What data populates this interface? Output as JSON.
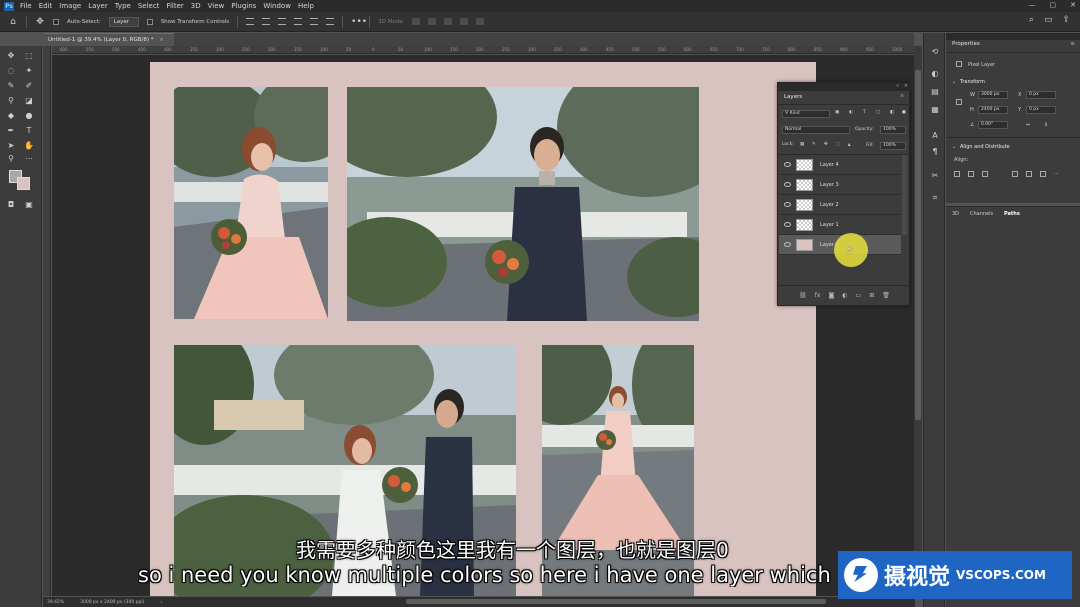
{
  "menu": [
    "File",
    "Edit",
    "Image",
    "Layer",
    "Type",
    "Select",
    "Filter",
    "3D",
    "View",
    "Plugins",
    "Window",
    "Help"
  ],
  "options_bar": {
    "auto_select_label": "Auto-Select:",
    "auto_select_value": "Layer",
    "transform_controls_label": "Show Transform Controls",
    "mode_3d": "3D Mode:"
  },
  "document": {
    "tab_title": "Untitled-1 @ 39.4% (Layer 0, RGB/8) *",
    "zoom": "39.42%",
    "doc_info": "3000 px x 2400 px (300 ppi)"
  },
  "ruler_top": [
    "600",
    "550",
    "500",
    "450",
    "400",
    "350",
    "300",
    "250",
    "200",
    "150",
    "100",
    "50",
    "0",
    "50",
    "100",
    "150",
    "200",
    "250",
    "300",
    "350",
    "400",
    "450",
    "500",
    "550",
    "600",
    "650",
    "700",
    "750",
    "800",
    "850",
    "900",
    "950",
    "1000"
  ],
  "properties": {
    "tab": "Properties",
    "kind": "Pixel Layer",
    "transform_title": "Transform",
    "w_label": "W",
    "w_value": "3000 px",
    "h_label": "H",
    "h_value": "2400 px",
    "x_label": "X",
    "x_value": "0 px",
    "y_label": "Y",
    "y_value": "0 px",
    "angle_value": "0.00°",
    "align_title": "Align and Distribute",
    "align_label": "Align:"
  },
  "bottom_tabs": [
    "3D",
    "Channels",
    "Paths"
  ],
  "layers_panel": {
    "tab": "Layers",
    "filter_kind": "Kind",
    "blend_mode": "Normal",
    "opacity_label": "Opacity:",
    "opacity_value": "100%",
    "lock_label": "Lock:",
    "fill_label": "Fill:",
    "fill_value": "100%",
    "layers": [
      {
        "name": "Layer 4",
        "selected": false
      },
      {
        "name": "Layer 3",
        "selected": false
      },
      {
        "name": "Layer 2",
        "selected": false
      },
      {
        "name": "Layer 1",
        "selected": false
      },
      {
        "name": "Layer 0",
        "selected": true
      }
    ]
  },
  "subtitles": {
    "cn": "我需要多种颜色这里我有一个图层，也就是图层0",
    "en": "so i need you know multiple colors so here i have one layer which"
  },
  "watermark": {
    "cn": "摄视觉",
    "en": "VSCOPS.COM"
  },
  "colors": {
    "artboard": "#d9c3c0",
    "foreground": "#a5aaa9",
    "background": "#d9c3c0",
    "watermark_bg": "#1f66c4"
  }
}
